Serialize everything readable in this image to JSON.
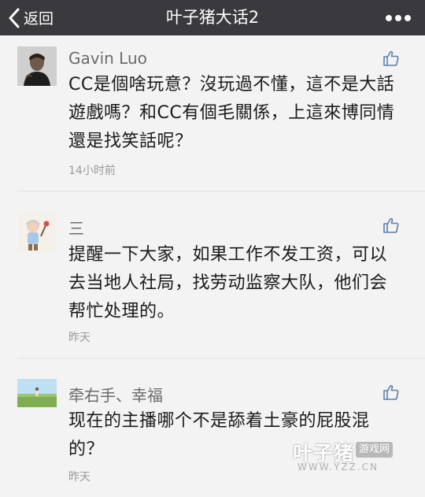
{
  "nav": {
    "back_label": "返回",
    "title": "叶子猪大话2",
    "back_icon": "chevron-left-icon",
    "more_icon": "ellipsis-icon"
  },
  "comments": [
    {
      "author": "Gavin Luo",
      "text": "CC是個啥玩意？沒玩過不懂，這不是大話遊戲嗎？和CC有個毛關係，上這來博同情還是找笑話呢？",
      "time": "14小时前"
    },
    {
      "author": "三",
      "text": "提醒一下大家，如果工作不发工资，可以去当地人社局，找劳动监察大队，他们会帮忙处理的。",
      "time": "昨天"
    },
    {
      "author": "牵右手、幸福",
      "text": "现在的主播哪个不是舔着土豪的屁股混的？",
      "time": "昨天"
    }
  ],
  "watermark": {
    "brand": "叶子猪",
    "tag": "游戏网",
    "url": "WWW.YZZ.CN"
  },
  "colors": {
    "topbar": "#3a3a3e",
    "background": "#f3f3f3",
    "like_icon": "#5a7fb0"
  }
}
